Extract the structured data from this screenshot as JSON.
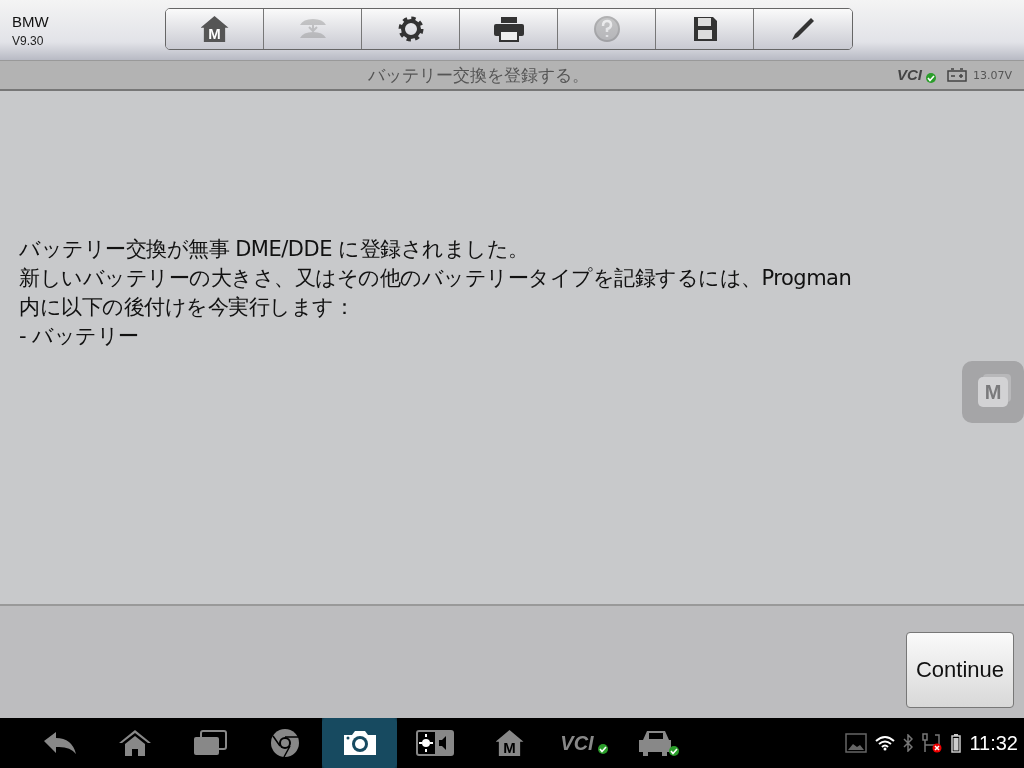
{
  "app": {
    "name": "BMW",
    "version": "V9.30"
  },
  "toolbar": [
    {
      "kind": "home",
      "label": "M",
      "disabled": false
    },
    {
      "kind": "transfer",
      "disabled": true
    },
    {
      "kind": "settings",
      "disabled": false
    },
    {
      "kind": "print",
      "disabled": false
    },
    {
      "kind": "help",
      "disabled": true
    },
    {
      "kind": "save",
      "disabled": false
    },
    {
      "kind": "edit",
      "disabled": false
    }
  ],
  "title_bar": {
    "title": "バッテリー交換を登録する。",
    "vci_label": "VCI",
    "vci_connected": true,
    "voltage": "13.07V"
  },
  "message": [
    "バッテリー交換が無事 DME/DDE に登録されました。",
    "新しいバッテリーの大きさ、又はその他のバッテリータイプを記録するには、Progman",
    "内に以下の後付けを今実行します：",
    "- バッテリー"
  ],
  "floating_button": {
    "label": "M"
  },
  "continue_button": "Continue",
  "nav_bar": [
    {
      "kind": "back",
      "selected": false
    },
    {
      "kind": "home",
      "selected": false
    },
    {
      "kind": "recents",
      "selected": false
    },
    {
      "kind": "browser",
      "selected": false
    },
    {
      "kind": "camera",
      "selected": true
    },
    {
      "kind": "display",
      "selected": false
    },
    {
      "kind": "app",
      "label": "M",
      "selected": false
    },
    {
      "kind": "vci",
      "label": "VCI",
      "selected": false
    },
    {
      "kind": "car",
      "selected": false
    }
  ],
  "status": {
    "wifi": true,
    "bluetooth": true,
    "time": "11:32"
  }
}
